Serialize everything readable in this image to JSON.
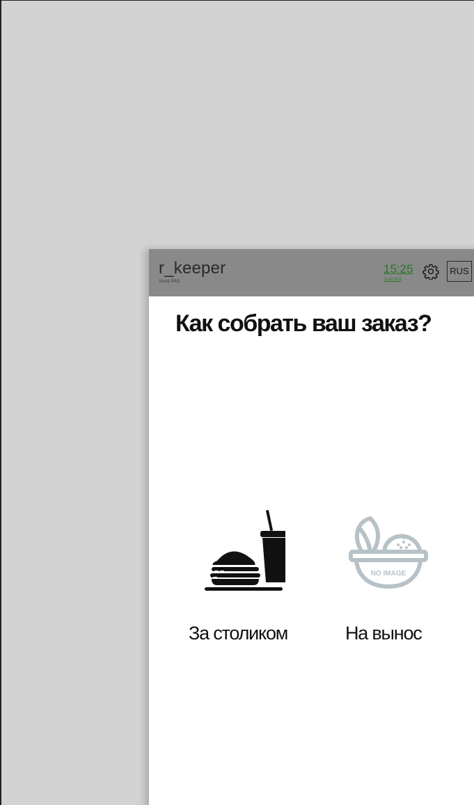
{
  "header": {
    "brand_title": "r_keeper",
    "brand_subtitle": "Kiosk PRO",
    "time": "15:25",
    "date": "11.02.2021",
    "settings_icon": "gear-icon",
    "language": "RUS",
    "colors": {
      "header_bg": "#898989",
      "time": "#1f7a1f"
    }
  },
  "main": {
    "question": "Как собрать ваш заказ?",
    "options": [
      {
        "label": "За столиком",
        "icon": "burger-and-drink-icon"
      },
      {
        "label": "На вынос",
        "icon": "no-image-placeholder-icon",
        "icon_text": "NO IMAGE"
      }
    ]
  },
  "colors": {
    "outer_background": "#d3d3d3",
    "panel_background": "#ffffff",
    "placeholder_icon": "#b7c2c8"
  }
}
